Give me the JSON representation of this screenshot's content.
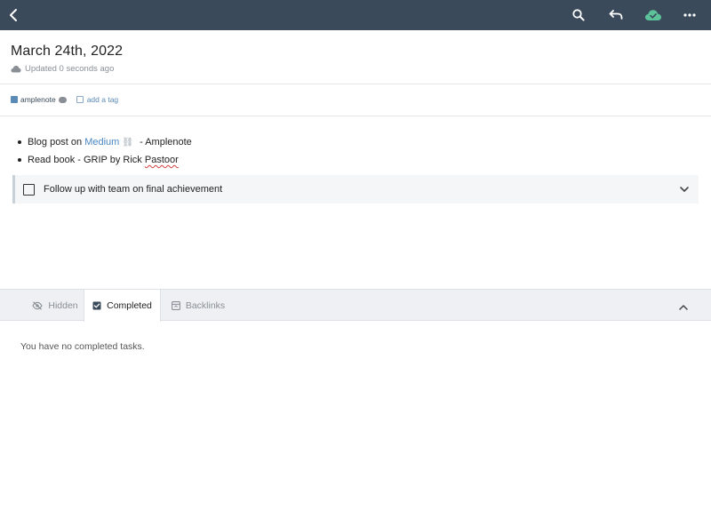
{
  "toolbar": {
    "back_icon": "chevron-left-icon",
    "search_icon": "search-icon",
    "undo_icon": "undo-icon",
    "sync_icon": "cloud-check-icon",
    "more_icon": "more-horizontal-icon",
    "sync_color": "#5cc29a",
    "bar_color": "#3a4a5a"
  },
  "note": {
    "title": "March 24th, 2022",
    "updated": "Updated 0 seconds ago"
  },
  "tags": {
    "items": [
      {
        "label": "amplenote"
      }
    ],
    "add_label": "add a tag"
  },
  "content": {
    "bullet1": {
      "prefix": "Blog post on ",
      "link": "Medium",
      "suffix": " - Amplenote"
    },
    "bullet2": {
      "prefix": "Read book - GRIP by Rick ",
      "misspelled": "Pastoor"
    },
    "task": {
      "text": "Follow up with team on final achievement",
      "checked": false
    }
  },
  "tabs": {
    "items": [
      {
        "label": "Hidden",
        "icon": "eye-off-icon"
      },
      {
        "label": "Completed",
        "icon": "checkbox-icon",
        "active": true
      },
      {
        "label": "Backlinks",
        "icon": "backlink-icon"
      }
    ]
  },
  "panel": {
    "empty_text": "You have no completed tasks."
  }
}
